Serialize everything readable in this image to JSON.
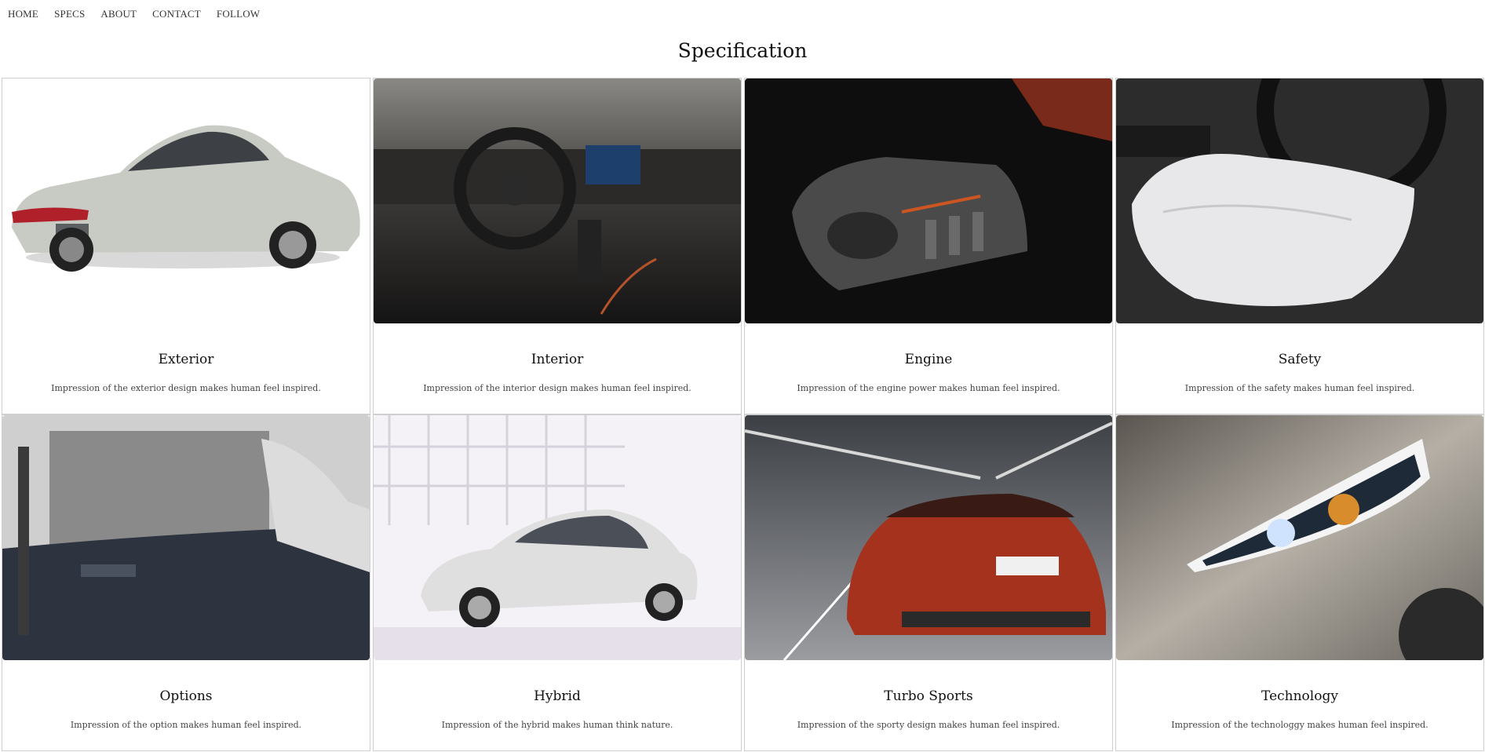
{
  "nav": {
    "items": [
      {
        "label": "HOME"
      },
      {
        "label": "SPECS"
      },
      {
        "label": "ABOUT"
      },
      {
        "label": "CONTACT"
      },
      {
        "label": "FOLLOW"
      }
    ]
  },
  "page": {
    "title": "Specification"
  },
  "cards": [
    {
      "title": "Exterior",
      "description": "Impression of the exterior design makes human feel inspired."
    },
    {
      "title": "Interior",
      "description": "Impression of the interior design makes human feel inspired."
    },
    {
      "title": "Engine",
      "description": "Impression of the engine power makes human feel inspired."
    },
    {
      "title": "Safety",
      "description": "Impression of the safety makes human feel inspired."
    },
    {
      "title": "Options",
      "description": "Impression of the option makes human feel inspired."
    },
    {
      "title": "Hybrid",
      "description": "Impression of the hybrid makes human think nature."
    },
    {
      "title": "Turbo Sports",
      "description": "Impression of the sporty design makes human feel inspired."
    },
    {
      "title": "Technology",
      "description": "Impression of the technologgy makes human feel inspired."
    }
  ]
}
